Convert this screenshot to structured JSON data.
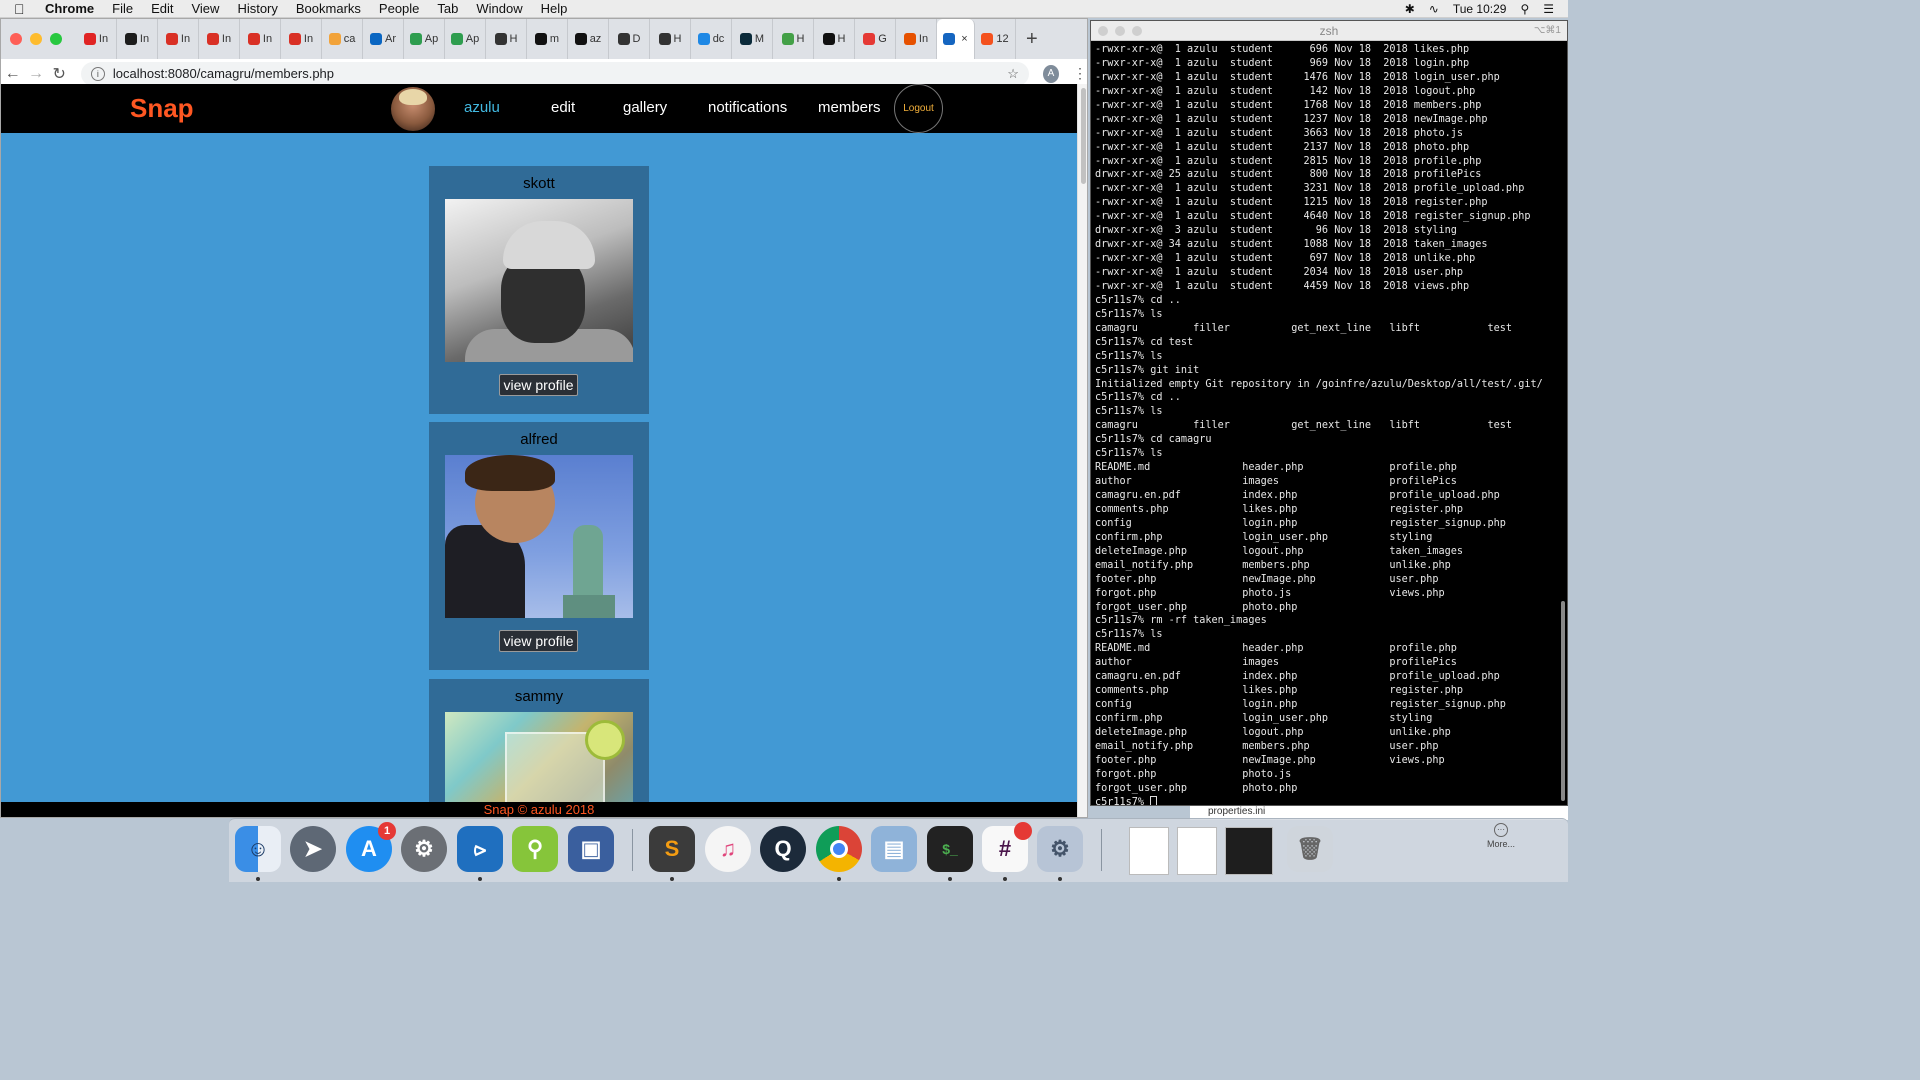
{
  "menubar": {
    "apple": "",
    "items": [
      "Chrome",
      "File",
      "Edit",
      "View",
      "History",
      "Bookmarks",
      "People",
      "Tab",
      "Window",
      "Help"
    ],
    "clock": "Tue 10:29"
  },
  "browser": {
    "url": "localhost:8080/camagru/members.php",
    "profile_initial": "A",
    "tabs": [
      {
        "label": "In",
        "color": "#e02424"
      },
      {
        "label": "In",
        "color": "#1d1d1d"
      },
      {
        "label": "In",
        "color": "#d93025"
      },
      {
        "label": "In",
        "color": "#d93025"
      },
      {
        "label": "In",
        "color": "#d93025"
      },
      {
        "label": "In",
        "color": "#d93025"
      },
      {
        "label": "ca",
        "color": "#f2a33a"
      },
      {
        "label": "Ar",
        "color": "#0a66c2"
      },
      {
        "label": "Ap",
        "color": "#2e9d4f"
      },
      {
        "label": "Ap",
        "color": "#2e9d4f"
      },
      {
        "label": "H",
        "color": "#333333"
      },
      {
        "label": "m",
        "color": "#111111"
      },
      {
        "label": "az",
        "color": "#111111"
      },
      {
        "label": "D",
        "color": "#333333"
      },
      {
        "label": "H",
        "color": "#333333"
      },
      {
        "label": "dc",
        "color": "#1e88e5"
      },
      {
        "label": "M",
        "color": "#0b2a3a"
      },
      {
        "label": "H",
        "color": "#43a047"
      },
      {
        "label": "H",
        "color": "#111111"
      },
      {
        "label": "G",
        "color": "#e53935"
      },
      {
        "label": "In",
        "color": "#e65100"
      },
      {
        "label": "",
        "color": "#1565c0",
        "active": true
      },
      {
        "label": "12",
        "color": "#f4511e"
      }
    ]
  },
  "site": {
    "logo": "Snap",
    "nav": {
      "user": "azulu",
      "edit": "edit",
      "gallery": "gallery",
      "notifications": "notifications",
      "members": "members",
      "logout": "Logout"
    },
    "members": [
      {
        "name": "skott",
        "button": "view profile"
      },
      {
        "name": "alfred",
        "button": "view profile"
      },
      {
        "name": "sammy",
        "button": "view profile"
      }
    ],
    "footer": "Snap © azulu 2018"
  },
  "terminal": {
    "title": "zsh",
    "shortcut": "⌥⌘1",
    "lines": [
      "-rwxr-xr-x@  1 azulu  student      696 Nov 18  2018 likes.php",
      "-rwxr-xr-x@  1 azulu  student      969 Nov 18  2018 login.php",
      "-rwxr-xr-x@  1 azulu  student     1476 Nov 18  2018 login_user.php",
      "-rwxr-xr-x@  1 azulu  student      142 Nov 18  2018 logout.php",
      "-rwxr-xr-x@  1 azulu  student     1768 Nov 18  2018 members.php",
      "-rwxr-xr-x@  1 azulu  student     1237 Nov 18  2018 newImage.php",
      "-rwxr-xr-x@  1 azulu  student     3663 Nov 18  2018 photo.js",
      "-rwxr-xr-x@  1 azulu  student     2137 Nov 18  2018 photo.php",
      "-rwxr-xr-x@  1 azulu  student     2815 Nov 18  2018 profile.php",
      "drwxr-xr-x@ 25 azulu  student      800 Nov 18  2018 profilePics",
      "-rwxr-xr-x@  1 azulu  student     3231 Nov 18  2018 profile_upload.php",
      "-rwxr-xr-x@  1 azulu  student     1215 Nov 18  2018 register.php",
      "-rwxr-xr-x@  1 azulu  student     4640 Nov 18  2018 register_signup.php",
      "drwxr-xr-x@  3 azulu  student       96 Nov 18  2018 styling",
      "drwxr-xr-x@ 34 azulu  student     1088 Nov 18  2018 taken_images",
      "-rwxr-xr-x@  1 azulu  student      697 Nov 18  2018 unlike.php",
      "-rwxr-xr-x@  1 azulu  student     2034 Nov 18  2018 user.php",
      "-rwxr-xr-x@  1 azulu  student     4459 Nov 18  2018 views.php",
      "c5r11s7% cd ..",
      "c5r11s7% ls",
      "camagru         filler          get_next_line   libft           test",
      "c5r11s7% cd test",
      "c5r11s7% ls",
      "c5r11s7% git init",
      "Initialized empty Git repository in /goinfre/azulu/Desktop/all/test/.git/",
      "c5r11s7% cd ..",
      "c5r11s7% ls",
      "camagru         filler          get_next_line   libft           test",
      "c5r11s7% cd camagru",
      "c5r11s7% ls",
      "README.md               header.php              profile.php",
      "author                  images                  profilePics",
      "camagru.en.pdf          index.php               profile_upload.php",
      "comments.php            likes.php               register.php",
      "config                  login.php               register_signup.php",
      "confirm.php             login_user.php          styling",
      "deleteImage.php         logout.php              taken_images",
      "email_notify.php        members.php             unlike.php",
      "footer.php              newImage.php            user.php",
      "forgot.php              photo.js                views.php",
      "forgot_user.php         photo.php",
      "c5r11s7% rm -rf taken_images",
      "c5r11s7% ls",
      "README.md               header.php              profile.php",
      "author                  images                  profilePics",
      "camagru.en.pdf          index.php               profile_upload.php",
      "comments.php            likes.php               register.php",
      "config                  login.php               register_signup.php",
      "confirm.php             login_user.php          styling",
      "deleteImage.php         logout.php              unlike.php",
      "email_notify.php        members.php             user.php",
      "footer.php              newImage.php            views.php",
      "forgot.php              photo.js",
      "forgot_user.php         photo.php"
    ],
    "prompt": "c5r11s7% "
  },
  "behind_window": {
    "file": "properties.ini"
  },
  "dock": {
    "more_label": "More...",
    "app_store_badge": "1",
    "icons": [
      "finder-icon",
      "launchpad-icon",
      "app-store-icon",
      "system-preferences-icon",
      "vscode-icon",
      "android-studio-icon",
      "virtualbox-icon",
      "sublime-text-icon",
      "itunes-icon",
      "quicktime-icon",
      "chrome-icon",
      "preview-icon",
      "terminal-icon",
      "slack-icon",
      "settings-icon"
    ]
  }
}
